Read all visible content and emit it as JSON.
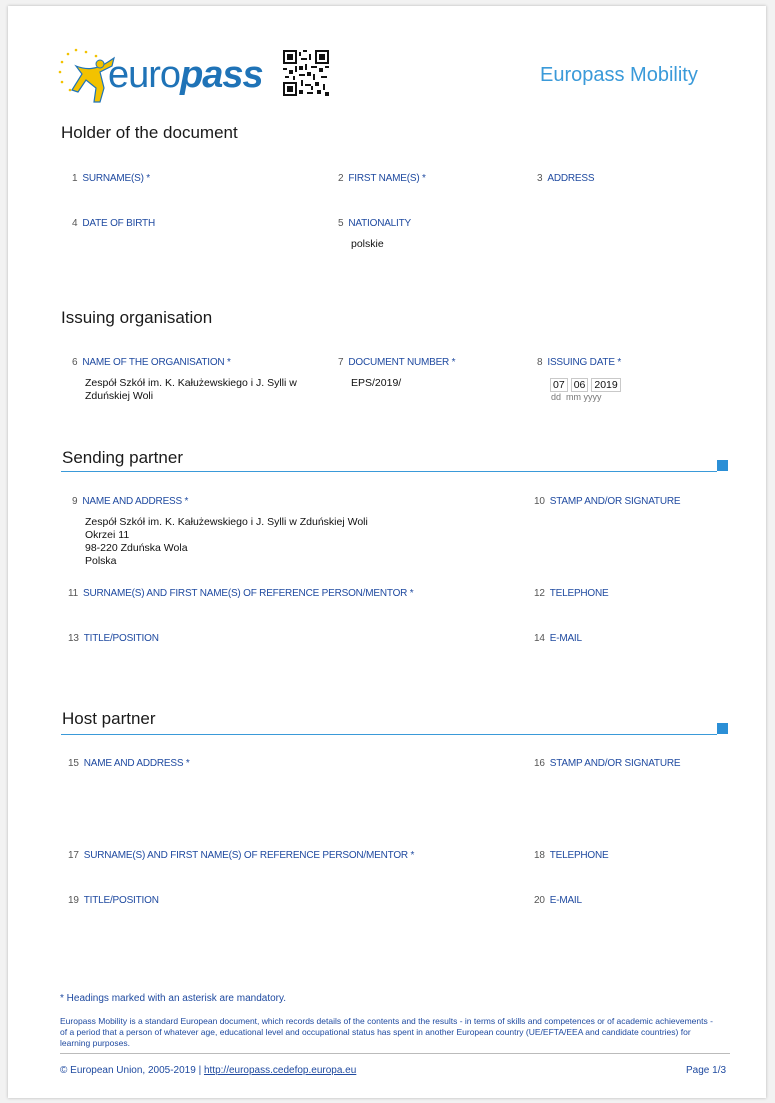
{
  "header": {
    "logo_euro": "euro",
    "logo_pass": "pass",
    "title": "Europass Mobility"
  },
  "holder": {
    "title": "Holder of the document",
    "fields": [
      {
        "num": "1",
        "label": "SURNAME(S) *",
        "value": ""
      },
      {
        "num": "2",
        "label": "FIRST NAME(S) *",
        "value": ""
      },
      {
        "num": "3",
        "label": "ADDRESS",
        "value": ""
      },
      {
        "num": "4",
        "label": "DATE OF BIRTH",
        "value": ""
      },
      {
        "num": "5",
        "label": "NATIONALITY",
        "value": "polskie"
      }
    ]
  },
  "issuing": {
    "title": "Issuing organisation",
    "org_num": "6",
    "org_label": "NAME OF THE ORGANISATION *",
    "org_value_1": "Zespół Szkół im. K. Kałużewskiego i J. Sylli w",
    "org_value_2": "Zduńskiej Woli",
    "doc_num": "7",
    "doc_label": "DOCUMENT NUMBER *",
    "doc_value": "EPS/2019/",
    "date_num": "8",
    "date_label": "ISSUING DATE *",
    "date_dd": "07",
    "date_mm": "06",
    "date_yyyy": "2019",
    "date_hint": "dd  mm yyyy"
  },
  "sending": {
    "title": "Sending partner",
    "f9_num": "9",
    "f9_label": "NAME AND ADDRESS *",
    "f9_lines": [
      "Zespół Szkół im. K. Kałużewskiego i J. Sylli w Zduńskiej Woli",
      "Okrzei 11",
      "98-220 Zduńska Wola",
      "Polska"
    ],
    "f10_num": "10",
    "f10_label": "STAMP AND/OR SIGNATURE",
    "f11_num": "11",
    "f11_label": "SURNAME(S) AND FIRST NAME(S) OF REFERENCE PERSON/MENTOR *",
    "f12_num": "12",
    "f12_label": "TELEPHONE",
    "f13_num": "13",
    "f13_label": "TITLE/POSITION",
    "f14_num": "14",
    "f14_label": "E-MAIL"
  },
  "host": {
    "title": "Host partner",
    "f15_num": "15",
    "f15_label": "NAME AND ADDRESS *",
    "f16_num": "16",
    "f16_label": "STAMP AND/OR SIGNATURE",
    "f17_num": "17",
    "f17_label": "SURNAME(S) AND FIRST NAME(S) OF REFERENCE PERSON/MENTOR *",
    "f18_num": "18",
    "f18_label": "TELEPHONE",
    "f19_num": "19",
    "f19_label": "TITLE/POSITION",
    "f20_num": "20",
    "f20_label": "E-MAIL"
  },
  "footer": {
    "mandatory_note": "* Headings marked with an asterisk are mandatory.",
    "description": "Europass Mobility is a standard European document, which records details of the contents and the results - in terms of skills and competences or of academic achievements - of a period that a person of whatever age, educational level and occupational status has spent in another European country (UE/EFTA/EEA and candidate countries) for learning purposes.",
    "copyright": "© European Union, 2005-2019 |",
    "link": "http://europass.cedefop.europa.eu",
    "page": "Page 1/3"
  },
  "colors": {
    "accent": "#3a9ad9",
    "label_blue": "#1f4aa0",
    "logo_blue": "#1f73b7",
    "logo_yellow": "#f2c200"
  }
}
